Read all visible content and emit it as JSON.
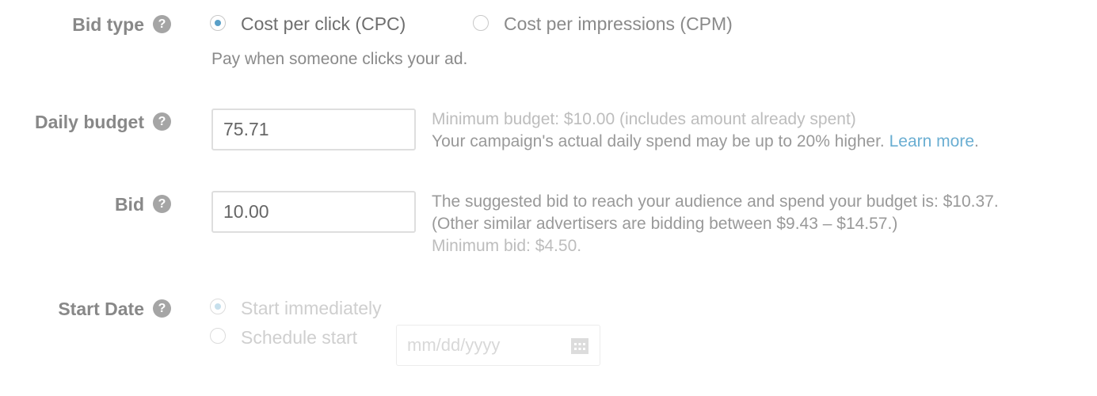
{
  "bid_type": {
    "label": "Bid type",
    "options": [
      {
        "label": "Cost per click (CPC)",
        "selected": true
      },
      {
        "label": "Cost per impressions (CPM)",
        "selected": false
      }
    ],
    "description": "Pay when someone clicks your ad."
  },
  "daily_budget": {
    "label": "Daily budget",
    "value": "75.71",
    "hint_line1": "Minimum budget: $10.00 (includes amount already spent)",
    "hint_line2": "Your campaign's actual daily spend may be up to 20% higher.",
    "learn_more": "Learn more",
    "period": "."
  },
  "bid": {
    "label": "Bid",
    "value": "10.00",
    "hint_line1": "The suggested bid to reach your audience and spend your budget is: $10.37.",
    "hint_line2": "(Other similar advertisers are bidding between $9.43 – $14.57.)",
    "hint_line3": "Minimum bid: $4.50."
  },
  "start_date": {
    "label": "Start Date",
    "options": [
      {
        "label": "Start immediately",
        "selected": true
      },
      {
        "label": "Schedule start",
        "selected": false
      }
    ],
    "date_placeholder": "mm/dd/yyyy"
  },
  "help_glyph": "?",
  "colors": {
    "accent": "#5aa0c8",
    "link": "#6aaed2",
    "help_icon": "#a5a5a5"
  }
}
